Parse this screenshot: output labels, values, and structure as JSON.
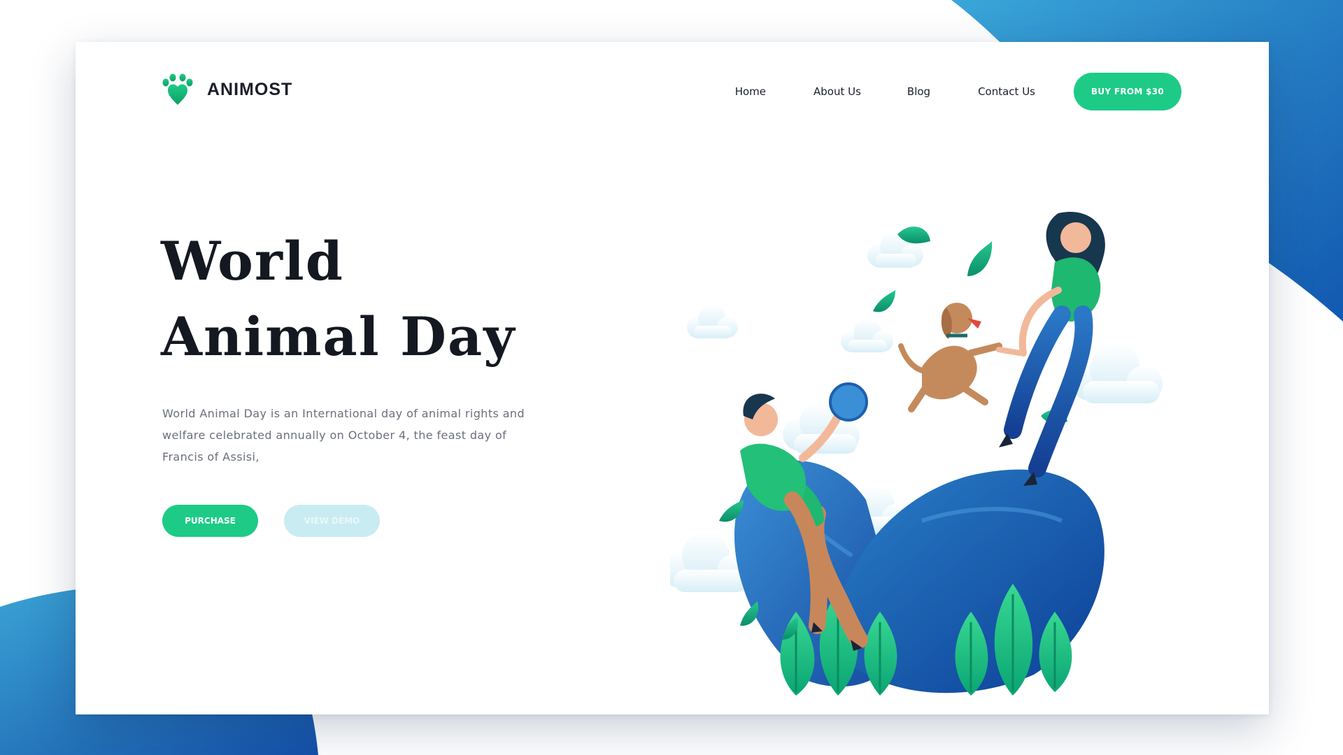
{
  "brand": {
    "name": "ANIMOST",
    "icon": "paw-icon",
    "color": "#1dcb87"
  },
  "nav": {
    "items": [
      "Home",
      "About Us",
      "Blog",
      "Contact Us"
    ],
    "cta_label": "BUY FROM $30"
  },
  "hero": {
    "title_line1": "World",
    "title_line2": "Animal Day",
    "description": "World Animal Day is an International day of animal rights and welfare celebrated annually on October 4, the feast day of Francis of Assisi,",
    "primary_button": "PURCHASE",
    "secondary_button": "VIEW DEMO"
  },
  "colors": {
    "accent_green": "#1dcb87",
    "deep_blue": "#1565b0",
    "light_blue": "#3aa3d4",
    "text_dark": "#141820"
  },
  "illustration": "people-playing-with-dog-illustration"
}
